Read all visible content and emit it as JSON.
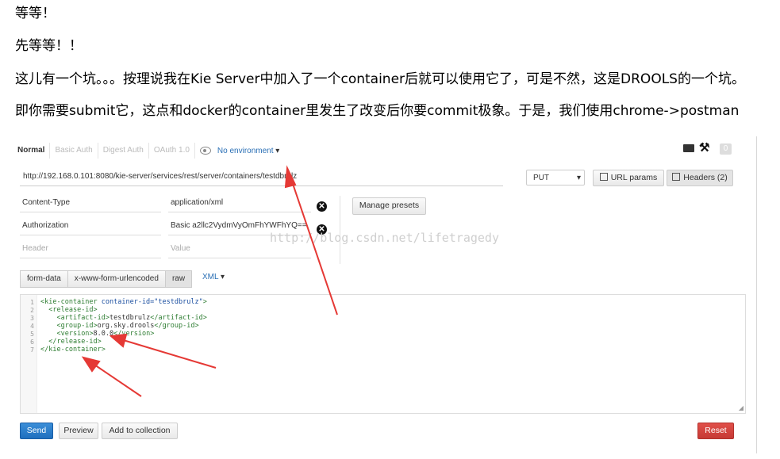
{
  "article": {
    "p1": "等等！",
    "p2": "先等等！！",
    "p3": "这儿有一个坑。。。按理说我在Kie Server中加入了一个container后就可以使用它了，可是不然，这是DROOLS的一个坑。",
    "p4": "即你需要submit它，这点和docker的container里发生了改变后你要commit极象。于是，我们使用chrome->postman"
  },
  "postman": {
    "auth_tabs": [
      "Normal",
      "Basic Auth",
      "Digest Auth",
      "OAuth 1.0"
    ],
    "environment": "No environment",
    "header_count_badge": "0",
    "url": "http://192.168.0.101:8080/kie-server/services/rest/server/containers/testdbrulz",
    "method": "PUT",
    "url_params_label": "URL params",
    "headers_label": "Headers (2)",
    "headers": [
      {
        "key": "Content-Type",
        "value": "application/xml"
      },
      {
        "key": "Authorization",
        "value": "Basic a2llc2VydmVyOmFhYWFhYQ=="
      }
    ],
    "header_key_placeholder": "Header",
    "header_value_placeholder": "Value",
    "manage_presets_label": "Manage presets",
    "body_tabs": [
      "form-data",
      "x-www-form-urlencoded",
      "raw"
    ],
    "body_type": "XML",
    "code_lines": [
      {
        "n": "1",
        "indent": "",
        "open": "<kie-container ",
        "attr": "container-id=\"testdbrulz\"",
        "close": ">"
      },
      {
        "n": "2",
        "indent": "  ",
        "open": "<release-id>",
        "attr": "",
        "close": ""
      },
      {
        "n": "3",
        "indent": "    ",
        "open": "<artifact-id>",
        "text": "testdbrulz",
        "end": "</artifact-id>"
      },
      {
        "n": "4",
        "indent": "    ",
        "open": "<group-id>",
        "text": "org.sky.drools",
        "end": "</group-id>"
      },
      {
        "n": "5",
        "indent": "    ",
        "open": "<version>",
        "text": "8.0.0",
        "end": "</version>"
      },
      {
        "n": "6",
        "indent": "  ",
        "open": "</release-id>",
        "attr": "",
        "close": ""
      },
      {
        "n": "7",
        "indent": "",
        "open": "</kie-container>",
        "attr": "",
        "close": ""
      }
    ],
    "send_label": "Send",
    "preview_label": "Preview",
    "add_collection_label": "Add to collection",
    "reset_label": "Reset"
  },
  "watermark": "http://blog.csdn.net/lifetragedy",
  "colors": {
    "arrow": "#e53935",
    "send": "#2a7cc9",
    "reset": "#d9443f",
    "link": "#2a6fb5"
  }
}
